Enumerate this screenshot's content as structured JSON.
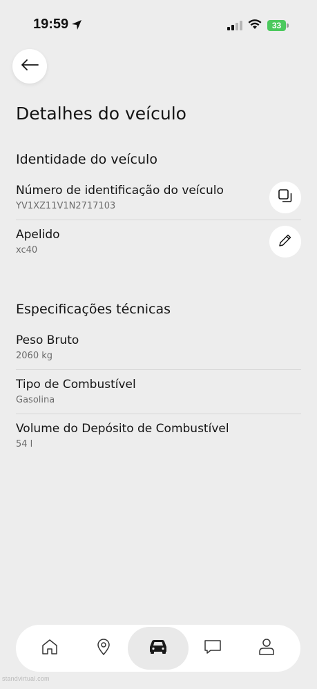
{
  "status_bar": {
    "time": "19:59",
    "battery": "33"
  },
  "page": {
    "title": "Detalhes do veículo"
  },
  "identity": {
    "section_title": "Identidade do veículo",
    "vin_label": "Número de identificação do veículo",
    "vin_value": "YV1XZ11V1N2717103",
    "nickname_label": "Apelido",
    "nickname_value": "xc40"
  },
  "specs": {
    "section_title": "Especificações técnicas",
    "items": [
      {
        "label": "Peso Bruto",
        "value": "2060 kg"
      },
      {
        "label": "Tipo de Combustível",
        "value": "Gasolina"
      },
      {
        "label": "Volume do Depósito de Combustível",
        "value": "54 l"
      }
    ]
  },
  "tabbar": {
    "items": [
      "home-icon",
      "location-pin-icon",
      "car-icon",
      "chat-icon",
      "profile-icon"
    ],
    "active": "car-icon"
  },
  "watermark": "standvirtual.com"
}
